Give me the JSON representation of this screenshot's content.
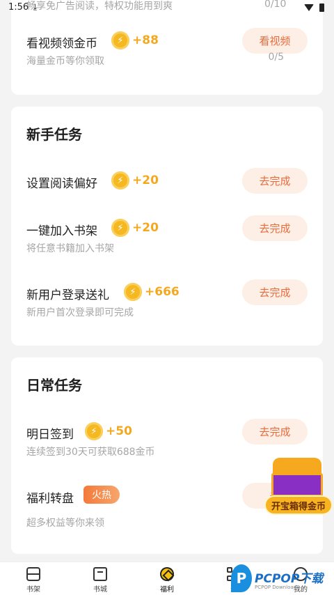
{
  "status_bar": {
    "time": "1:56",
    "download_icon": "download-icon",
    "wifi_icon": "wifi-icon",
    "battery_icon": "battery-icon"
  },
  "top_partial": {
    "desc": "畅享免广告阅读，特权功能用到爽",
    "progress": "0/10"
  },
  "video_task": {
    "name": "看视频领金币",
    "reward": "+88",
    "desc": "海量金币等你领取",
    "button": "看视频",
    "progress": "0/5"
  },
  "newbie": {
    "title": "新手任务",
    "tasks": [
      {
        "name": "设置阅读偏好",
        "reward": "+20",
        "desc": "",
        "button": "去完成"
      },
      {
        "name": "一键加入书架",
        "reward": "+20",
        "desc": "将任意书籍加入书架",
        "button": "去完成"
      },
      {
        "name": "新用户登录送礼",
        "reward": "+666",
        "desc": "新用户首次登录即可完成",
        "button": "去完成"
      }
    ]
  },
  "daily": {
    "title": "日常任务",
    "tasks": [
      {
        "name": "明日签到",
        "reward": "+50",
        "desc": "连续签到30天可获取688金币",
        "button": "去完成"
      },
      {
        "name": "福利转盘",
        "tag": "火热",
        "desc": "超多权益等你来领",
        "button": "去"
      }
    ]
  },
  "chest": {
    "label": "开宝箱得金币"
  },
  "tabbar": [
    {
      "label": "书架",
      "icon": "bookshelf-icon"
    },
    {
      "label": "书城",
      "icon": "bookstore-icon"
    },
    {
      "label": "福利",
      "icon": "welfare-icon"
    },
    {
      "label": "分",
      "icon": "category-icon"
    },
    {
      "label": "我的",
      "icon": "profile-icon"
    }
  ],
  "watermark": {
    "text": "PCPOP下载",
    "sub": "PCPOP Download"
  },
  "colors": {
    "accent": "#f3a91f",
    "button_text": "#e96b3b",
    "button_bg": "#fdefe6"
  }
}
